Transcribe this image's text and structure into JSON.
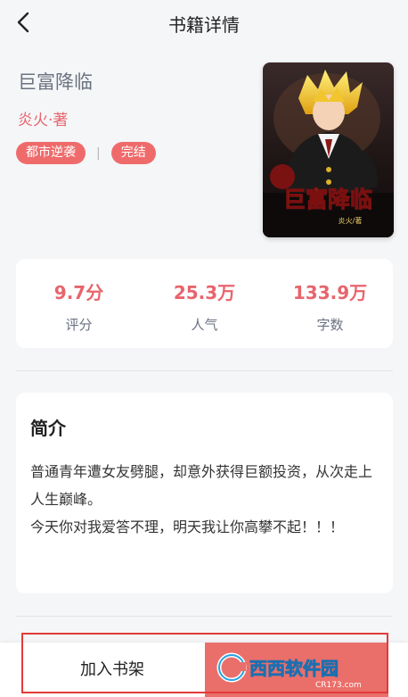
{
  "nav": {
    "title": "书籍详情",
    "back_icon": "back-chevron-icon"
  },
  "book": {
    "title": "巨富降临",
    "author": "炎火·著",
    "tags": [
      "都市逆袭",
      "完结"
    ],
    "cover": {
      "title": "巨富降临",
      "author": "炎火/著"
    }
  },
  "stats": [
    {
      "value": "9.7分",
      "label": "评分"
    },
    {
      "value": "25.3万",
      "label": "人气"
    },
    {
      "value": "133.9万",
      "label": "字数"
    }
  ],
  "intro": {
    "title": "简介",
    "text": "普通青年遭女友劈腿，却意外获得巨额投资，从次走上人生巅峰。\n今天你对我爱答不理，明天我让你高攀不起！！！"
  },
  "bottom": {
    "shelf_label": "加入书架"
  },
  "watermark": {
    "brand": "西西软件园",
    "url": "CR173.com"
  },
  "colors": {
    "accent": "#e8646c",
    "tag_bg": "#ef6b6b",
    "highlight": "#e23a3a",
    "background": "#f5f6f8"
  }
}
